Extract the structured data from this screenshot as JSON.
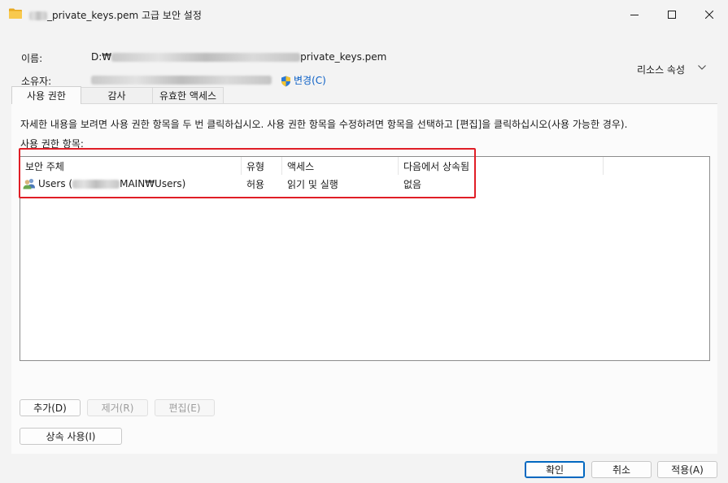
{
  "window": {
    "title_prefix_redacted": true,
    "title_suffix": "_private_keys.pem 고급 보안 설정"
  },
  "info": {
    "name_label": "이름:",
    "name_prefix": "D:₩",
    "name_suffix": "private_keys.pem",
    "owner_label": "소유자:",
    "change_link": "변경(C)"
  },
  "resource_properties": "리소스 속성",
  "tabs": [
    {
      "label": "사용 권한",
      "active": true
    },
    {
      "label": "감사",
      "active": false
    },
    {
      "label": "유효한 액세스",
      "active": false
    }
  ],
  "description": "자세한 내용을 보려면 사용 권한 항목을 두 번 클릭하십시오. 사용 권한 항목을 수정하려면 항목을 선택하고 [편집]을 클릭하십시오(사용 가능한 경우).",
  "entries_label": "사용 권한 항목:",
  "table": {
    "columns": [
      "보안 주체",
      "유형",
      "액세스",
      "다음에서 상속됨"
    ],
    "rows": [
      {
        "principal_prefix": "Users (",
        "principal_suffix": "MAIN₩Users)",
        "type": "허용",
        "access": "읽기 및 실행",
        "inherited": "없음"
      }
    ]
  },
  "buttons": {
    "add": "추가(D)",
    "remove": "제거(R)",
    "edit": "편집(E)",
    "inherit": "상속 사용(I)",
    "ok": "확인",
    "cancel": "취소",
    "apply": "적용(A)"
  },
  "colors": {
    "highlight": "#e01e26",
    "link": "#0a5fc6",
    "folder": "#f2c14e"
  }
}
